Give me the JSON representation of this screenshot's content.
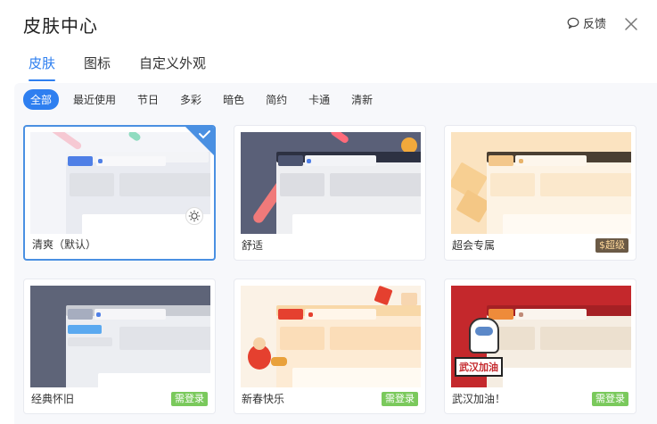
{
  "window": {
    "title": "皮肤中心",
    "feedback_label": "反馈"
  },
  "tabs": [
    {
      "label": "皮肤",
      "active": true
    },
    {
      "label": "图标",
      "active": false
    },
    {
      "label": "自定义外观",
      "active": false
    }
  ],
  "filters": [
    {
      "label": "全部",
      "active": true
    },
    {
      "label": "最近使用",
      "active": false
    },
    {
      "label": "节日",
      "active": false
    },
    {
      "label": "多彩",
      "active": false
    },
    {
      "label": "暗色",
      "active": false
    },
    {
      "label": "简约",
      "active": false
    },
    {
      "label": "卡通",
      "active": false
    },
    {
      "label": "清新",
      "active": false
    }
  ],
  "skins": [
    {
      "name": "清爽（默认）",
      "selected": true,
      "badge": ""
    },
    {
      "name": "舒适",
      "selected": false,
      "badge": ""
    },
    {
      "name": "超会专属",
      "selected": false,
      "badge": "$超级"
    },
    {
      "name": "经典怀旧",
      "selected": false,
      "badge": "需登录"
    },
    {
      "name": "新春快乐",
      "selected": false,
      "badge": "需登录"
    },
    {
      "name": "武汉加油！",
      "selected": false,
      "badge": "需登录"
    }
  ],
  "wuhan_banner": "武汉加油",
  "colors": {
    "accent": "#2e7ff0",
    "badge_green": "#7ac95c",
    "badge_gold": "#6b5a46"
  },
  "icons": {
    "feedback": "speech-bubble-icon",
    "close": "close-icon",
    "selected": "checkmark-icon",
    "sun": "sun-icon"
  }
}
